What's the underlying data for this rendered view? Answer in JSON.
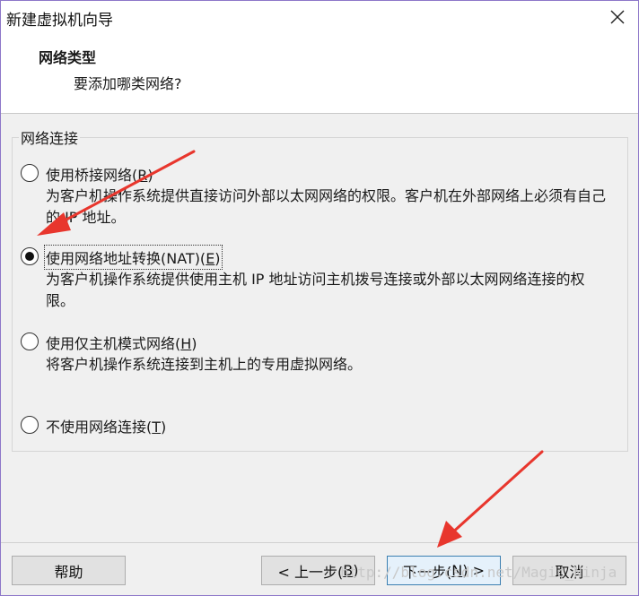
{
  "window": {
    "title": "新建虚拟机向导"
  },
  "header": {
    "title": "网络类型",
    "subtitle": "要添加哪类网络?"
  },
  "group": {
    "legend": "网络连接",
    "options": [
      {
        "label_pre": "使用桥接网络(",
        "mnemonic": "R",
        "label_post": ")",
        "description": "为客户机操作系统提供直接访问外部以太网网络的权限。客户机在外部网络上必须有自己的 IP 地址。",
        "checked": false
      },
      {
        "label_pre": "使用网络地址转换(NAT)(",
        "mnemonic": "E",
        "label_post": ")",
        "description": "为客户机操作系统提供使用主机 IP 地址访问主机拨号连接或外部以太网网络连接的权限。",
        "checked": true
      },
      {
        "label_pre": "使用仅主机模式网络(",
        "mnemonic": "H",
        "label_post": ")",
        "description": "将客户机操作系统连接到主机上的专用虚拟网络。",
        "checked": false
      },
      {
        "label_pre": "不使用网络连接(",
        "mnemonic": "T",
        "label_post": ")",
        "description": "",
        "checked": false
      }
    ]
  },
  "buttons": {
    "help": "帮助",
    "back_pre": "< 上一步(",
    "back_mnemonic": "B",
    "back_post": ")",
    "next_pre": "下一步(",
    "next_mnemonic": "N",
    "next_post": ") >",
    "cancel": "取消"
  },
  "watermark": "http://blog.csdn.net/Magic_Ninja",
  "colors": {
    "window_border": "#8d77c9",
    "arrow": "#e8362d",
    "default_button_border": "#3c7fb1"
  }
}
